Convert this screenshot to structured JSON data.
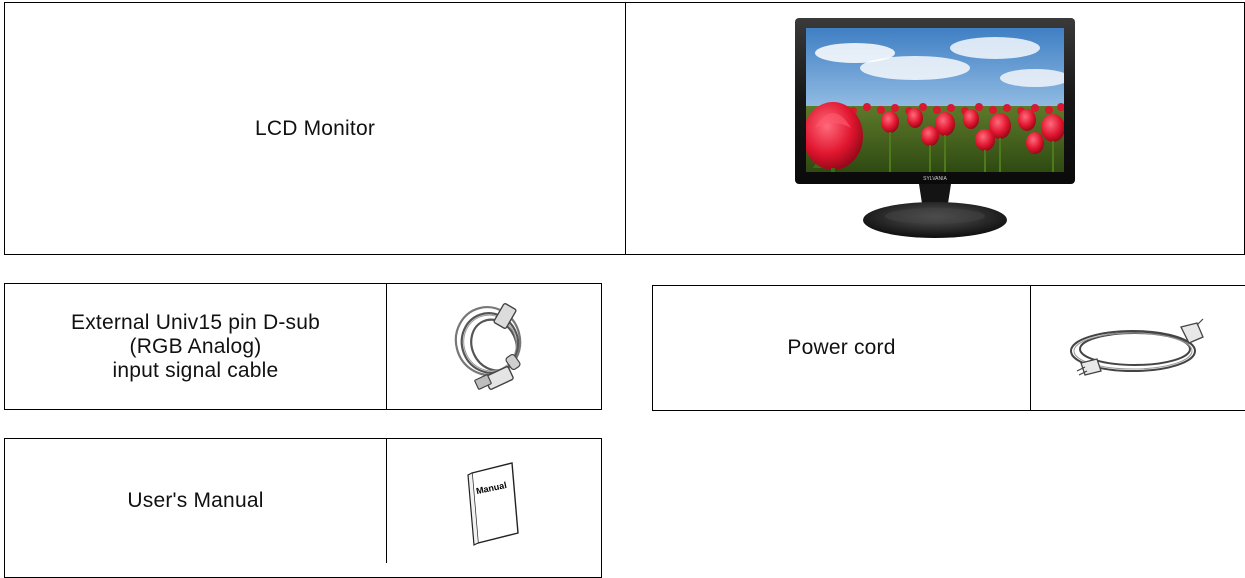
{
  "items": [
    {
      "label_lines": [
        "LCD Monitor"
      ],
      "image": "lcd-monitor-photo",
      "monitor_brand": "SYLVANIA"
    },
    {
      "label_lines": [
        "External Univ15 pin D-sub",
        "(RGB Analog)",
        "input signal cable"
      ],
      "image": "vga-cable-drawing"
    },
    {
      "label_lines": [
        "Power cord"
      ],
      "image": "power-cord-drawing"
    },
    {
      "label_lines": [
        "User's Manual"
      ],
      "image": "manual-booklet-drawing",
      "booklet_text": "Manual"
    }
  ]
}
